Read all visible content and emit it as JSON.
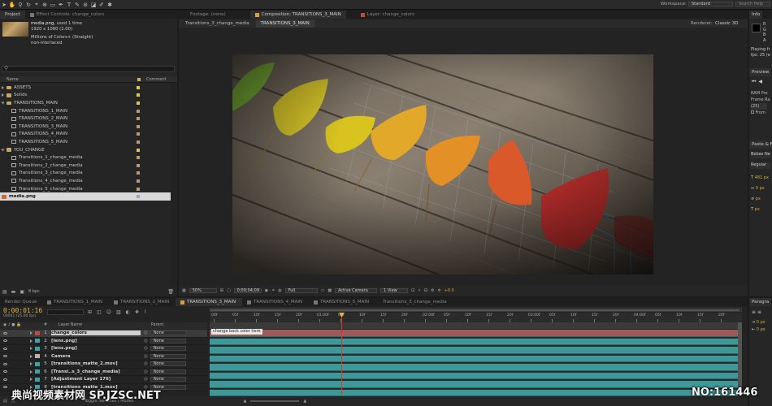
{
  "toolbar": {
    "workspace_label": "Workspace:",
    "workspace_value": "Standard",
    "search_help_placeholder": "Search Help"
  },
  "project_panel": {
    "tabs": [
      "Project",
      "Effect Controls: change_colors"
    ],
    "item": {
      "name": "media.png",
      "used": ", used 1 time",
      "dims": "1920 x 1080 (1.00)",
      "colors": "Millions of Colors+ (Straight)",
      "interlace": "non-interlaced"
    },
    "search_placeholder": "",
    "columns": {
      "name": "Name",
      "comment": "Comment"
    },
    "items": [
      {
        "label": "ASSETS",
        "type": "folder",
        "indent": 0,
        "expanded": false,
        "color": "#d8c95b"
      },
      {
        "label": "Solids",
        "type": "folder",
        "indent": 0,
        "expanded": false,
        "color": "#d8c95b"
      },
      {
        "label": "TRANSITIONS_MAIN",
        "type": "folder",
        "indent": 0,
        "expanded": true,
        "color": "#d8c95b"
      },
      {
        "label": "TRANSITIONS_1_MAIN",
        "type": "comp",
        "indent": 1,
        "color": "#b59a73"
      },
      {
        "label": "TRANSITIONS_2_MAIN",
        "type": "comp",
        "indent": 1,
        "color": "#b59a73"
      },
      {
        "label": "TRANSITIONS_3_MAIN",
        "type": "comp",
        "indent": 1,
        "color": "#b59a73"
      },
      {
        "label": "TRANSITIONS_4_MAIN",
        "type": "comp",
        "indent": 1,
        "color": "#b59a73"
      },
      {
        "label": "TRANSITIONS_5_MAIN",
        "type": "comp",
        "indent": 1,
        "color": "#b59a73"
      },
      {
        "label": "YOU_CHANGE",
        "type": "folder",
        "indent": 0,
        "expanded": true,
        "color": "#d8c95b"
      },
      {
        "label": "Transitions_1_change_media",
        "type": "comp",
        "indent": 1,
        "color": "#b59a73"
      },
      {
        "label": "Transitions_2_change_media",
        "type": "comp",
        "indent": 1,
        "color": "#b59a73"
      },
      {
        "label": "Transitions_3_change_media",
        "type": "comp",
        "indent": 1,
        "color": "#b59a73"
      },
      {
        "label": "Transitions_4_change_media",
        "type": "comp",
        "indent": 1,
        "color": "#b59a73"
      },
      {
        "label": "Transitions_5_change_media",
        "type": "comp",
        "indent": 1,
        "color": "#b59a73"
      },
      {
        "label": "media.png",
        "type": "image",
        "indent": 0,
        "selected": true,
        "color": "#9ca6c7"
      }
    ],
    "footer_bpc": "8 bpc"
  },
  "viewer": {
    "tabs": [
      "Footage: (none)",
      "Composition: TRANSITIONS_3_MAIN",
      "Layer: change_colors"
    ],
    "breadcrumbs": [
      "Transitions_3_change_media",
      "TRANSITIONS_3_MAIN"
    ],
    "renderer_label": "Renderer:",
    "renderer_value": "Classic 3D",
    "controls": {
      "zoom": "50%",
      "timecode": "0;00;04;09",
      "resolution": "Full",
      "camera": "Active Camera",
      "views": "1 View",
      "exposure": "+0.0"
    }
  },
  "right_panels": {
    "info_tab": "Info",
    "info_letters": [
      "R",
      "G",
      "B",
      "A"
    ],
    "playing": "Playing fr",
    "fps": "fps: 25 (e",
    "preview_tab": "Preview",
    "ram_preview": "RAM Pre",
    "frame_rate": "Frame Ra",
    "frame_rate_value": "(25)",
    "from_current": "From",
    "paragraph_char_tab": "Paragra",
    "chars_tab": "Paste & Fo",
    "font": "Bebas Ne",
    "style": "Regular",
    "values": [
      "481 px",
      "0 px",
      "px",
      "px"
    ],
    "paragraph_tab": "Paragra"
  },
  "timeline": {
    "tabs": [
      "Render Queue",
      "TRANSITIONS_1_MAIN",
      "TRANSITIONS_2_MAIN",
      "TRANSITIONS_3_MAIN",
      "TRANSITIONS_4_MAIN",
      "TRANSITIONS_5_MAIN",
      "Transitions_3_change_media"
    ],
    "current_time": "0:00:01:16",
    "current_time_sub": "00041 (25.00 fps)",
    "columns": {
      "num": "#",
      "layer_name": "Layer Name",
      "parent": "Parent"
    },
    "layers": [
      {
        "num": "1",
        "name": "change_colors",
        "parent": "None",
        "color": "#c34747",
        "selected": true
      },
      {
        "num": "2",
        "name": "[lens.png]",
        "parent": "None",
        "color": "#3fa1a8"
      },
      {
        "num": "3",
        "name": "[lens.png]",
        "parent": "None",
        "color": "#3fa1a8"
      },
      {
        "num": "4",
        "name": "Camera",
        "parent": "None",
        "color": "#bfb1a4"
      },
      {
        "num": "5",
        "name": "[transitions_matte_2.mov]",
        "parent": "None",
        "color": "#3fa1a8"
      },
      {
        "num": "6",
        "name": "[Transi..s_3_change_media]",
        "parent": "None",
        "color": "#3fa1a8"
      },
      {
        "num": "7",
        "name": "[Adjustment Layer 176]",
        "parent": "None",
        "color": "#3fa1a8"
      },
      {
        "num": "8",
        "name": "[transitions_matte_1.mov]",
        "parent": "None",
        "color": "#3fa1a8"
      }
    ],
    "ruler_ticks": [
      "00f",
      "05f",
      "10f",
      "15f",
      "20f",
      "01:00f",
      "05f",
      "10f",
      "15f",
      "20f",
      "02:00f",
      "05f",
      "10f",
      "15f",
      "20f",
      "03:00f",
      "05f",
      "10f",
      "15f",
      "20f",
      "04:00f",
      "05f",
      "10f",
      "15f",
      "20f"
    ],
    "marker_label": "change back color here",
    "bar_color_top": "#9c5a5a",
    "bar_color": "#3f9898",
    "footer_toggle": "Toggle Switches / Modes"
  },
  "watermark": {
    "left": "典尚视频素材网 SP.JZSC.NET",
    "right": "NO:161446"
  }
}
